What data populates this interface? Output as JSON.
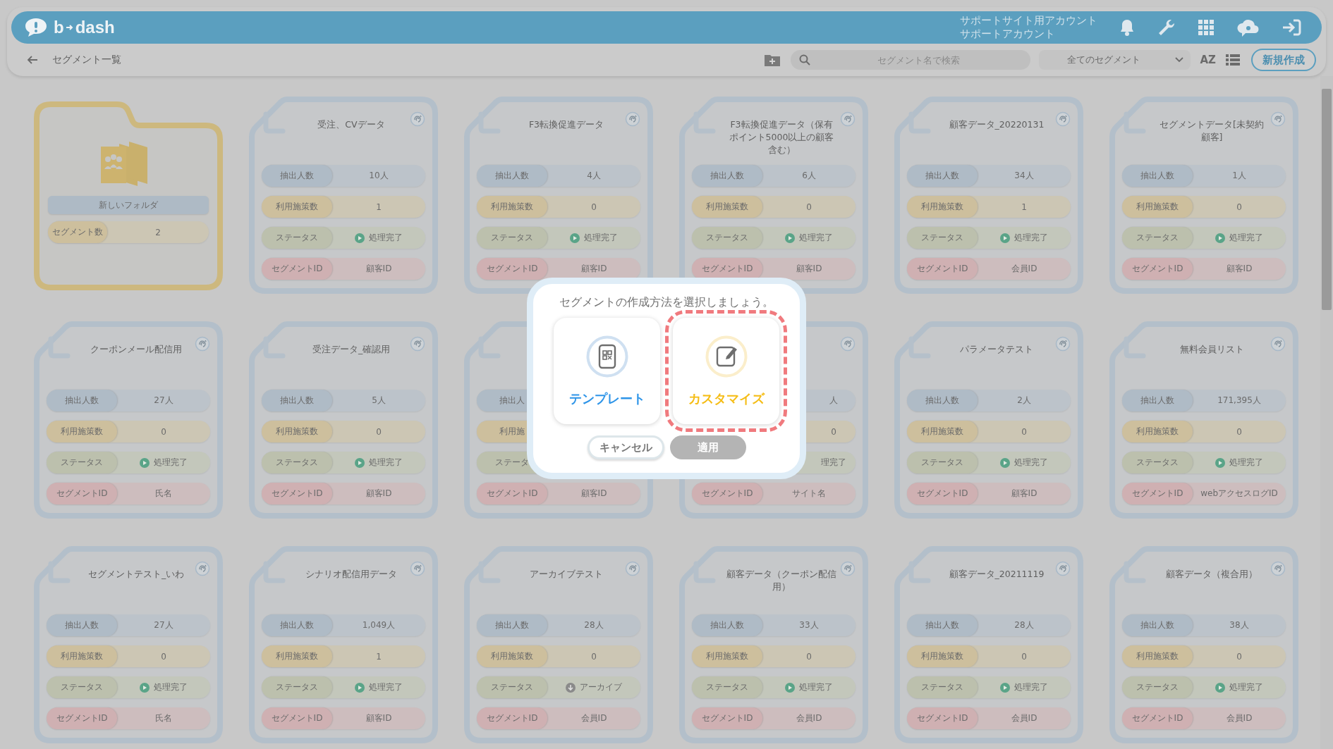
{
  "header": {
    "logo": {
      "left": "b",
      "right": "dash"
    },
    "account": [
      "サポートサイト用アカウント",
      "サポートアカウント"
    ]
  },
  "toolbar": {
    "page_title": "セグメント一覧",
    "search": {
      "placeholder": "セグメント名で検索"
    },
    "filter": "全てのセグメント",
    "sort_label": "AZ",
    "new_button": "新規作成"
  },
  "cards": [
    {
      "kind": "folder",
      "title": "新しいフォルダ",
      "fields": [
        {
          "kind": "segments",
          "label": "セグメント数",
          "value": "2"
        }
      ]
    },
    {
      "kind": "segment",
      "corner_icon": true,
      "title": "受注、CVデータ",
      "fields": [
        {
          "kind": "count",
          "label": "抽出人数",
          "value": "10人"
        },
        {
          "kind": "measures",
          "label": "利用施策数",
          "value": "1"
        },
        {
          "kind": "done",
          "label": "ステータス",
          "value": "処理完了"
        },
        {
          "kind": "id",
          "label": "セグメントID",
          "value": "顧客ID"
        }
      ]
    },
    {
      "kind": "segment",
      "corner_icon": true,
      "title": "F3転換促進データ",
      "fields": [
        {
          "kind": "count",
          "label": "抽出人数",
          "value": "4人"
        },
        {
          "kind": "measures",
          "label": "利用施策数",
          "value": "0"
        },
        {
          "kind": "done",
          "label": "ステータス",
          "value": "処理完了"
        },
        {
          "kind": "id",
          "label": "セグメントID",
          "value": "顧客ID"
        }
      ]
    },
    {
      "kind": "segment",
      "corner_icon": true,
      "title": "F3転換促進データ（保有ポイント5000以上の顧客含む）",
      "fields": [
        {
          "kind": "count",
          "label": "抽出人数",
          "value": "6人"
        },
        {
          "kind": "measures",
          "label": "利用施策数",
          "value": "0"
        },
        {
          "kind": "done",
          "label": "ステータス",
          "value": "処理完了"
        },
        {
          "kind": "id",
          "label": "セグメントID",
          "value": "顧客ID"
        }
      ]
    },
    {
      "kind": "segment",
      "corner_icon": true,
      "title": "顧客データ_20220131",
      "fields": [
        {
          "kind": "count",
          "label": "抽出人数",
          "value": "34人"
        },
        {
          "kind": "measures",
          "label": "利用施策数",
          "value": "1"
        },
        {
          "kind": "done",
          "label": "ステータス",
          "value": "処理完了"
        },
        {
          "kind": "id",
          "label": "セグメントID",
          "value": "会員ID"
        }
      ]
    },
    {
      "kind": "segment",
      "corner_icon": true,
      "title": "セグメントデータ[未契約顧客]",
      "fields": [
        {
          "kind": "count",
          "label": "抽出人数",
          "value": "1人"
        },
        {
          "kind": "measures",
          "label": "利用施策数",
          "value": "0"
        },
        {
          "kind": "done",
          "label": "ステータス",
          "value": "処理完了"
        },
        {
          "kind": "id",
          "label": "セグメントID",
          "value": "顧客ID"
        }
      ]
    },
    {
      "kind": "segment",
      "corner_icon": true,
      "title": "クーポンメール配信用",
      "fields": [
        {
          "kind": "count",
          "label": "抽出人数",
          "value": "27人"
        },
        {
          "kind": "measures",
          "label": "利用施策数",
          "value": "0"
        },
        {
          "kind": "done",
          "label": "ステータス",
          "value": "処理完了"
        },
        {
          "kind": "id",
          "label": "セグメントID",
          "value": "氏名"
        }
      ]
    },
    {
      "kind": "segment",
      "corner_icon": true,
      "title": "受注データ_確認用",
      "fields": [
        {
          "kind": "count",
          "label": "抽出人数",
          "value": "5人"
        },
        {
          "kind": "measures",
          "label": "利用施策数",
          "value": "0"
        },
        {
          "kind": "done",
          "label": "ステータス",
          "value": "処理完了"
        },
        {
          "kind": "id",
          "label": "セグメントID",
          "value": "顧客ID"
        }
      ]
    },
    {
      "kind": "segment",
      "corner_icon": false,
      "fields": [
        {
          "kind": "count",
          "label": "抽出人"
        },
        {
          "kind": "measures",
          "label": "利用施"
        },
        {
          "kind": "status",
          "label": "ステータ"
        },
        {
          "kind": "id",
          "label": "セグメントID",
          "value": "顧客ID"
        }
      ]
    },
    {
      "kind": "segment",
      "corner_icon": true,
      "fields": [
        {
          "kind": "count",
          "value": "人"
        },
        {
          "kind": "measures",
          "value": "0"
        },
        {
          "kind": "status",
          "value": "理完了"
        },
        {
          "kind": "id",
          "label": "セグメントID",
          "value": "サイト名"
        }
      ]
    },
    {
      "kind": "segment",
      "corner_icon": true,
      "title": "パラメータテスト",
      "fields": [
        {
          "kind": "count",
          "label": "抽出人数",
          "value": "2人"
        },
        {
          "kind": "measures",
          "label": "利用施策数",
          "value": "0"
        },
        {
          "kind": "done",
          "label": "ステータス",
          "value": "処理完了"
        },
        {
          "kind": "id",
          "label": "セグメントID",
          "value": "顧客ID"
        }
      ]
    },
    {
      "kind": "segment",
      "corner_icon": true,
      "title": "無料会員リスト",
      "fields": [
        {
          "kind": "count",
          "label": "抽出人数",
          "value": "171,395人"
        },
        {
          "kind": "measures",
          "label": "利用施策数",
          "value": "0"
        },
        {
          "kind": "done",
          "label": "ステータス",
          "value": "処理完了"
        },
        {
          "kind": "id",
          "label": "セグメントID",
          "value": "webアクセスログID"
        }
      ]
    },
    {
      "kind": "segment",
      "corner_icon": true,
      "title": "セグメントテスト_いわ",
      "fields": [
        {
          "kind": "count",
          "label": "抽出人数",
          "value": "27人"
        },
        {
          "kind": "measures",
          "label": "利用施策数",
          "value": "0"
        },
        {
          "kind": "done",
          "label": "ステータス",
          "value": "処理完了"
        },
        {
          "kind": "id",
          "label": "セグメントID",
          "value": "氏名"
        }
      ]
    },
    {
      "kind": "segment",
      "corner_icon": true,
      "title": "シナリオ配信用データ",
      "fields": [
        {
          "kind": "count",
          "label": "抽出人数",
          "value": "1,049人"
        },
        {
          "kind": "measures",
          "label": "利用施策数",
          "value": "1"
        },
        {
          "kind": "done",
          "label": "ステータス",
          "value": "処理完了"
        },
        {
          "kind": "id",
          "label": "セグメントID",
          "value": "顧客ID"
        }
      ]
    },
    {
      "kind": "segment",
      "corner_icon": true,
      "title": "アーカイブテスト",
      "fields": [
        {
          "kind": "count",
          "label": "抽出人数",
          "value": "28人"
        },
        {
          "kind": "measures",
          "label": "利用施策数",
          "value": "0"
        },
        {
          "kind": "archived",
          "label": "ステータス",
          "value": "アーカイブ"
        },
        {
          "kind": "id",
          "label": "セグメントID",
          "value": "会員ID"
        }
      ]
    },
    {
      "kind": "segment",
      "corner_icon": true,
      "title": "顧客データ（クーポン配信用）",
      "fields": [
        {
          "kind": "count",
          "label": "抽出人数",
          "value": "33人"
        },
        {
          "kind": "measures",
          "label": "利用施策数",
          "value": "0"
        },
        {
          "kind": "done",
          "label": "ステータス",
          "value": "処理完了"
        },
        {
          "kind": "id",
          "label": "セグメントID",
          "value": "会員ID"
        }
      ]
    },
    {
      "kind": "segment",
      "corner_icon": true,
      "title": "顧客データ_20211119",
      "fields": [
        {
          "kind": "count",
          "label": "抽出人数",
          "value": "28人"
        },
        {
          "kind": "measures",
          "label": "利用施策数",
          "value": "0"
        },
        {
          "kind": "done",
          "label": "ステータス",
          "value": "処理完了"
        },
        {
          "kind": "id",
          "label": "セグメントID",
          "value": "会員ID"
        }
      ]
    },
    {
      "kind": "segment",
      "corner_icon": true,
      "title": "顧客データ（複合用）",
      "fields": [
        {
          "kind": "count",
          "label": "抽出人数",
          "value": "38人"
        },
        {
          "kind": "measures",
          "label": "利用施策数",
          "value": "0"
        },
        {
          "kind": "done",
          "label": "ステータス",
          "value": "処理完了"
        },
        {
          "kind": "id",
          "label": "セグメントID",
          "value": "会員ID"
        }
      ]
    }
  ],
  "dialog": {
    "title": "セグメントの作成方法を選択しましょう。",
    "options": [
      {
        "kind": "template",
        "label": "テンプレート",
        "selected": false
      },
      {
        "kind": "custom",
        "label": "カスタマイズ",
        "selected": true
      }
    ],
    "buttons": [
      {
        "label": "キャンセル",
        "disabled": false
      },
      {
        "label": "適用",
        "disabled": true
      }
    ]
  }
}
